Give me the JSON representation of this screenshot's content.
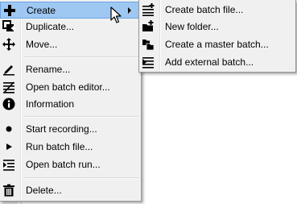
{
  "main_menu": {
    "items": [
      {
        "label": "Create",
        "icon": "plus-icon",
        "has_submenu": true,
        "highlighted": true
      },
      {
        "label": "Duplicate...",
        "icon": "duplicate-icon"
      },
      {
        "label": "Move...",
        "icon": "move-icon"
      },
      {
        "label": "Rename...",
        "icon": "rename-icon"
      },
      {
        "label": "Open batch editor...",
        "icon": "batch-editor-icon"
      },
      {
        "label": "Information",
        "icon": "info-icon"
      },
      {
        "label": "Start recording...",
        "icon": "record-icon"
      },
      {
        "label": "Run batch file...",
        "icon": "play-icon"
      },
      {
        "label": "Open batch run...",
        "icon": "batch-run-icon"
      },
      {
        "label": "Delete...",
        "icon": "trash-icon"
      }
    ]
  },
  "sub_menu": {
    "items": [
      {
        "label": "Create batch file...",
        "icon": "new-batch-file-icon"
      },
      {
        "label": "New folder...",
        "icon": "new-folder-icon"
      },
      {
        "label": "Create a master batch...",
        "icon": "master-batch-icon"
      },
      {
        "label": "Add external batch...",
        "icon": "external-batch-icon"
      }
    ]
  },
  "colors": {
    "menu_bg": "#f0f0f0",
    "highlight_bg": "#9ec7f2",
    "highlight_border": "#6aa5e3",
    "border": "#979797"
  }
}
